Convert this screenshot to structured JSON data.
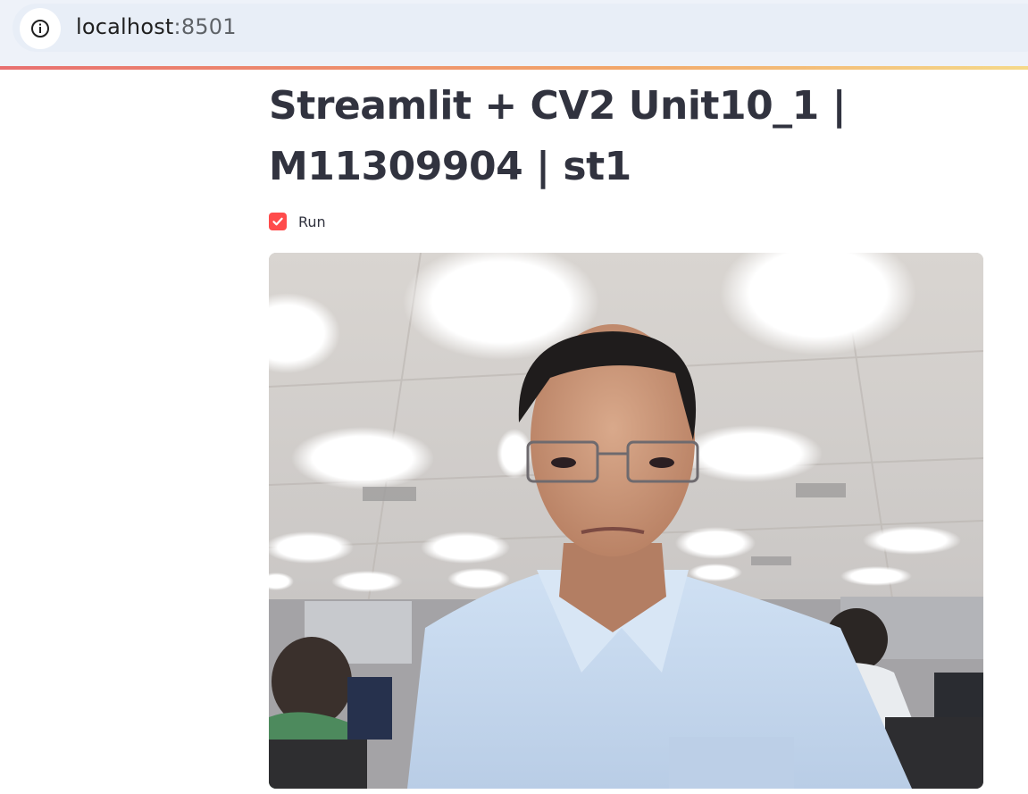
{
  "browser": {
    "url_host": "localhost",
    "url_port": ":8501",
    "info_icon": "info-circle-icon"
  },
  "app": {
    "title": "Streamlit + CV2 Unit10_1 | M11309904 | st1",
    "checkbox": {
      "label": "Run",
      "checked": true,
      "accent_color": "#ff4b4b"
    },
    "video": {
      "content": "webcam-frame"
    }
  },
  "colors": {
    "text": "#31333f",
    "decoration_start": "#e87070",
    "decoration_end": "#f5d98a"
  }
}
